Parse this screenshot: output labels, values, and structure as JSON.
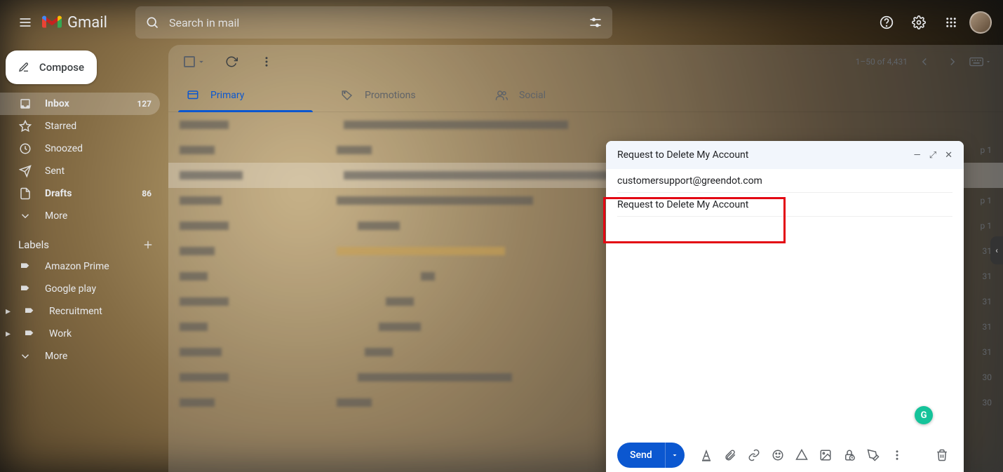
{
  "header": {
    "logo_text": "Gmail",
    "search_placeholder": "Search in mail"
  },
  "sidebar": {
    "compose_label": "Compose",
    "items": [
      {
        "label": "Inbox",
        "count": "127",
        "active": true,
        "icon": "inbox"
      },
      {
        "label": "Starred",
        "icon": "star"
      },
      {
        "label": "Snoozed",
        "icon": "clock"
      },
      {
        "label": "Sent",
        "icon": "send"
      },
      {
        "label": "Drafts",
        "count": "86",
        "icon": "file",
        "bold": true
      },
      {
        "label": "More",
        "icon": "chevron-down"
      }
    ],
    "labels_header": "Labels",
    "labels": [
      {
        "label": "Amazon Prime",
        "icon": "tag"
      },
      {
        "label": "Google play",
        "icon": "tag"
      },
      {
        "label": "Recruitment",
        "icon": "tag",
        "arrow": true
      },
      {
        "label": "Work",
        "icon": "tag",
        "arrow": true
      },
      {
        "label": "More",
        "icon": "chevron-down"
      }
    ]
  },
  "mail": {
    "range_text": "1–50 of 4,431",
    "tabs": [
      {
        "label": "Primary",
        "active": true
      },
      {
        "label": "Promotions"
      },
      {
        "label": "Social"
      }
    ],
    "row_dates": [
      "",
      "p 1",
      "",
      "p 1",
      "p 1",
      "31",
      "31",
      "31",
      "31",
      "31",
      "30",
      "30"
    ]
  },
  "compose": {
    "title": "Request to Delete My Account",
    "to_value": "customersupport@greendot.com",
    "subject_value": "Request to Delete My Account",
    "send_label": "Send"
  }
}
